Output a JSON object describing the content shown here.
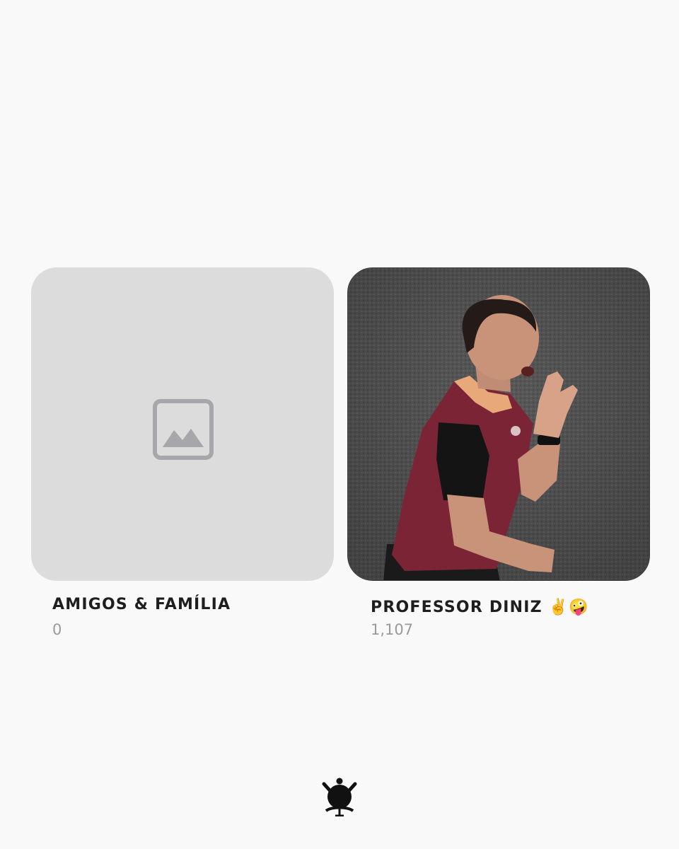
{
  "albums": [
    {
      "title": "AMIGOS & FAMÍLIA",
      "count": "0",
      "thumbnail": "empty",
      "placeholder_icon": "image-placeholder-icon"
    },
    {
      "title": "PROFESSOR DINIZ",
      "title_emoji": "✌️🤪",
      "count": "1,107",
      "thumbnail": "photo"
    }
  ],
  "footer": {
    "logo_icon": "corinthians-crest-icon"
  },
  "colors": {
    "background": "#f9f9f9",
    "placeholder": "#dcdcdc",
    "placeholder_icon": "#a7a7ab",
    "title": "#1e1e1e",
    "count": "#9a9a9a",
    "jersey": "#7a2436",
    "jersey_accent": "#e9a87a"
  }
}
